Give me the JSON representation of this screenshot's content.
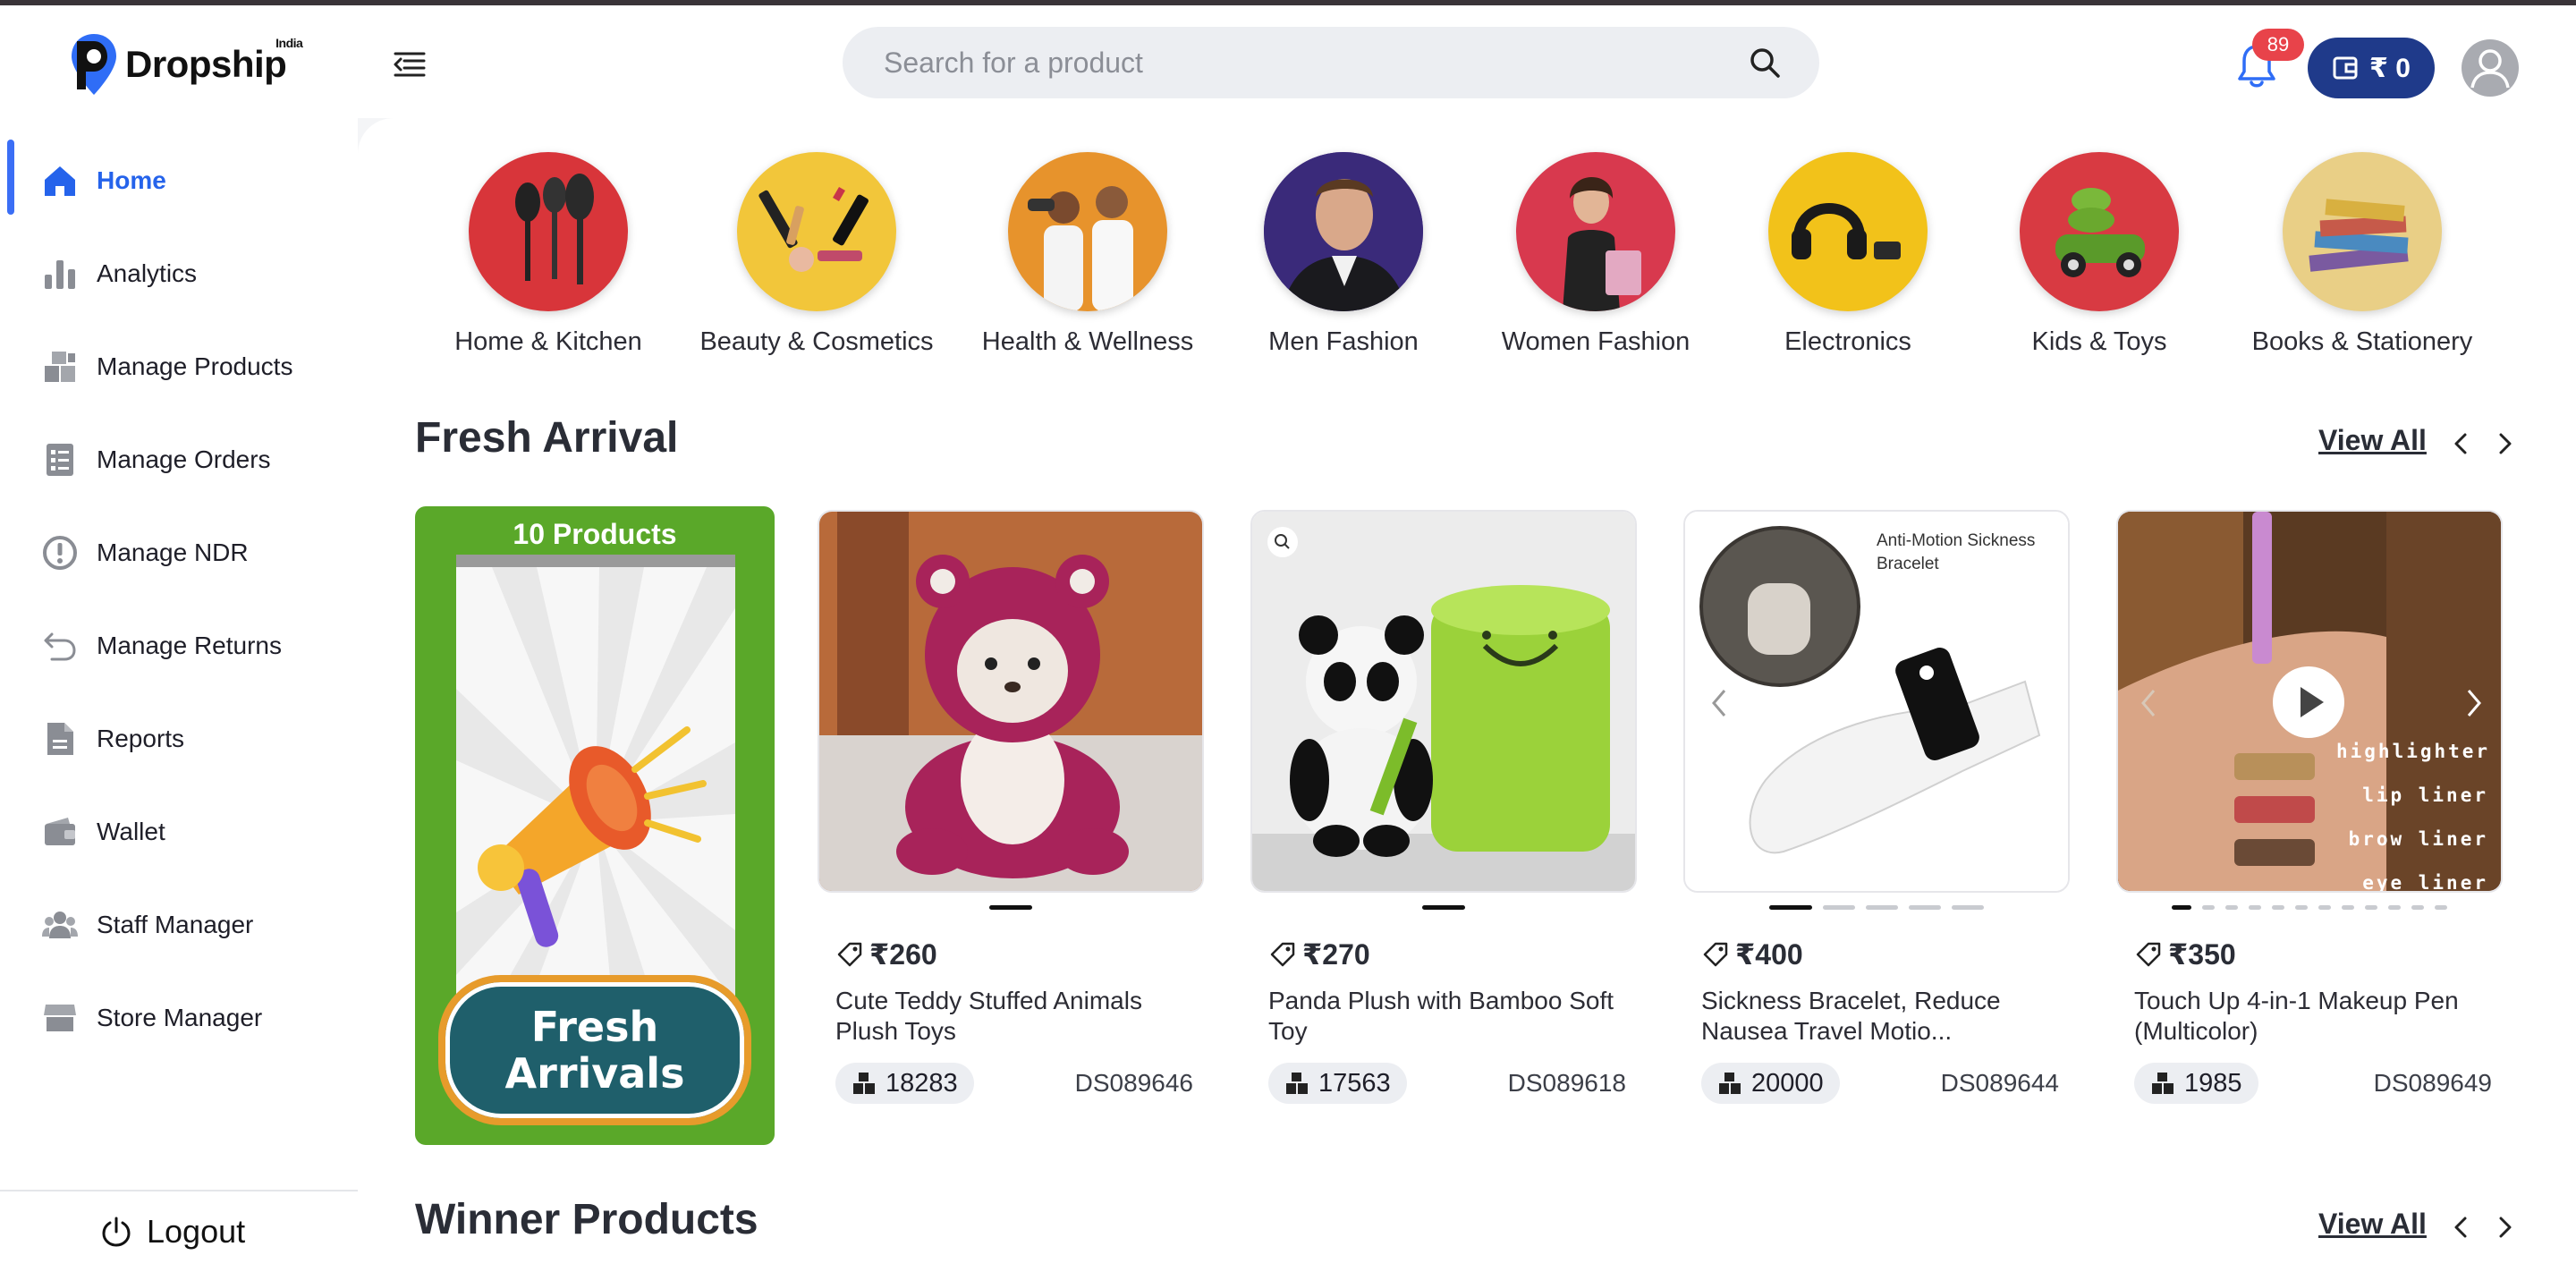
{
  "app": {
    "name": "Dropship",
    "name_sub": "India"
  },
  "header": {
    "search_placeholder": "Search for a product",
    "notification_count": "89",
    "wallet_balance": "₹ 0"
  },
  "sidebar": {
    "items": [
      {
        "label": "Home",
        "icon": "home-icon",
        "active": true
      },
      {
        "label": "Analytics",
        "icon": "analytics-icon"
      },
      {
        "label": "Manage Products",
        "icon": "products-icon"
      },
      {
        "label": "Manage Orders",
        "icon": "orders-icon"
      },
      {
        "label": "Manage NDR",
        "icon": "alert-circle-icon"
      },
      {
        "label": "Manage Returns",
        "icon": "return-icon"
      },
      {
        "label": "Reports",
        "icon": "report-icon"
      },
      {
        "label": "Wallet",
        "icon": "wallet-icon"
      },
      {
        "label": "Staff Manager",
        "icon": "staff-icon"
      },
      {
        "label": "Store Manager",
        "icon": "store-icon"
      }
    ],
    "logout_label": "Logout"
  },
  "categories": [
    {
      "label": "Home & Kitchen"
    },
    {
      "label": "Beauty & Cosmetics"
    },
    {
      "label": "Health & Wellness"
    },
    {
      "label": "Men Fashion"
    },
    {
      "label": "Women Fashion"
    },
    {
      "label": "Electronics"
    },
    {
      "label": "Kids & Toys"
    },
    {
      "label": "Books & Stationery"
    }
  ],
  "fresh_arrival": {
    "title": "Fresh Arrival",
    "view_all": "View All",
    "promo": {
      "count_label": "10 Products",
      "button_line1": "Fresh",
      "button_line2": "Arrivals"
    },
    "products": [
      {
        "price": "₹260",
        "name": "Cute Teddy Stuffed Animals Plush Toys",
        "stock": "18283",
        "sku": "DS089646"
      },
      {
        "price": "₹270",
        "name": "Panda Plush with Bamboo Soft Toy",
        "stock": "17563",
        "sku": "DS089618"
      },
      {
        "price": "₹400",
        "name": "Sickness Bracelet, Reduce Nausea Travel Motio...",
        "stock": "20000",
        "sku": "DS089644",
        "image_text": "Anti-Motion Sickness Bracelet"
      },
      {
        "price": "₹350",
        "name": "Touch Up 4-in-1 Makeup Pen (Multicolor)",
        "stock": "1985",
        "sku": "DS089649",
        "image_text": [
          "highlighter",
          "lip liner",
          "brow liner",
          "eye liner"
        ]
      }
    ]
  },
  "winner_products": {
    "title": "Winner Products",
    "view_all": "View All"
  },
  "colors": {
    "accent": "#2563eb",
    "wallet": "#1f3a8a",
    "badge": "#e8434a",
    "promo_green": "#5aa829"
  }
}
